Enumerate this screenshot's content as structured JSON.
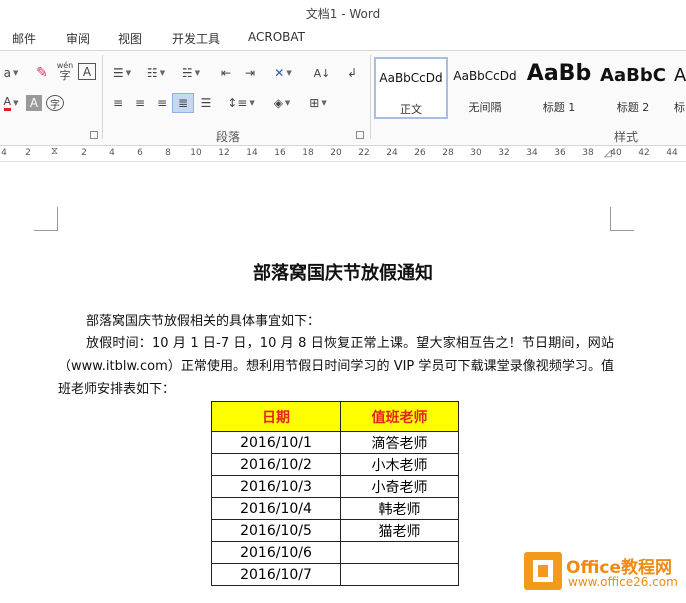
{
  "window": {
    "title": "文档1 - Word"
  },
  "ribbon_tabs": [
    "邮件",
    "审阅",
    "视图",
    "开发工具",
    "ACROBAT"
  ],
  "ribbon": {
    "font_group_fragment": "a",
    "phonetic_label": "wén",
    "phonetic_char": "字",
    "text_box_icon_label": "A",
    "char_shading_label": "A",
    "enclosed_char_label": "字",
    "group_paragraph": "段落",
    "group_styles": "样式",
    "styles": [
      {
        "sample": "AaBbCcDd",
        "name": "正文",
        "selected": true
      },
      {
        "sample": "AaBbCcDd",
        "name": "无间隔",
        "selected": false
      },
      {
        "sample": "AaBb",
        "name": "标题 1",
        "selected": false
      },
      {
        "sample": "AaBbC",
        "name": "标题 2",
        "selected": false
      },
      {
        "sample": "A",
        "name": "标",
        "selected": false
      }
    ]
  },
  "ruler": {
    "ticks": [
      "4",
      "2",
      "2",
      "4",
      "6",
      "8",
      "10",
      "12",
      "14",
      "16",
      "18",
      "20",
      "22",
      "24",
      "26",
      "28",
      "30",
      "32",
      "34",
      "36",
      "38",
      "40",
      "42",
      "44"
    ]
  },
  "document": {
    "title": "部落窝国庆节放假通知",
    "paragraphs": [
      "部落窝国庆节放假相关的具体事宜如下：",
      "放假时间：10 月 1 日-7 日，10 月 8 日恢复正常上课。望大家相互告之！节日期间，网站（www.itblw.com）正常使用。想利用节假日时间学习的 VIP 学员可下载课堂录像视频学习。值班老师安排表如下："
    ],
    "table": {
      "headers": [
        "日期",
        "值班老师"
      ],
      "rows": [
        [
          "2016/10/1",
          "滴答老师"
        ],
        [
          "2016/10/2",
          "小木老师"
        ],
        [
          "2016/10/3",
          "小奇老师"
        ],
        [
          "2016/10/4",
          "韩老师"
        ],
        [
          "2016/10/5",
          "猫老师"
        ],
        [
          "2016/10/6",
          ""
        ],
        [
          "2016/10/7",
          ""
        ]
      ]
    }
  },
  "watermark": {
    "brand": "Office教程网",
    "url": "www.office26.com"
  },
  "colors": {
    "header_bg": "#ffff00",
    "header_text": "#e8231f",
    "watermark": "#ef8b10"
  }
}
